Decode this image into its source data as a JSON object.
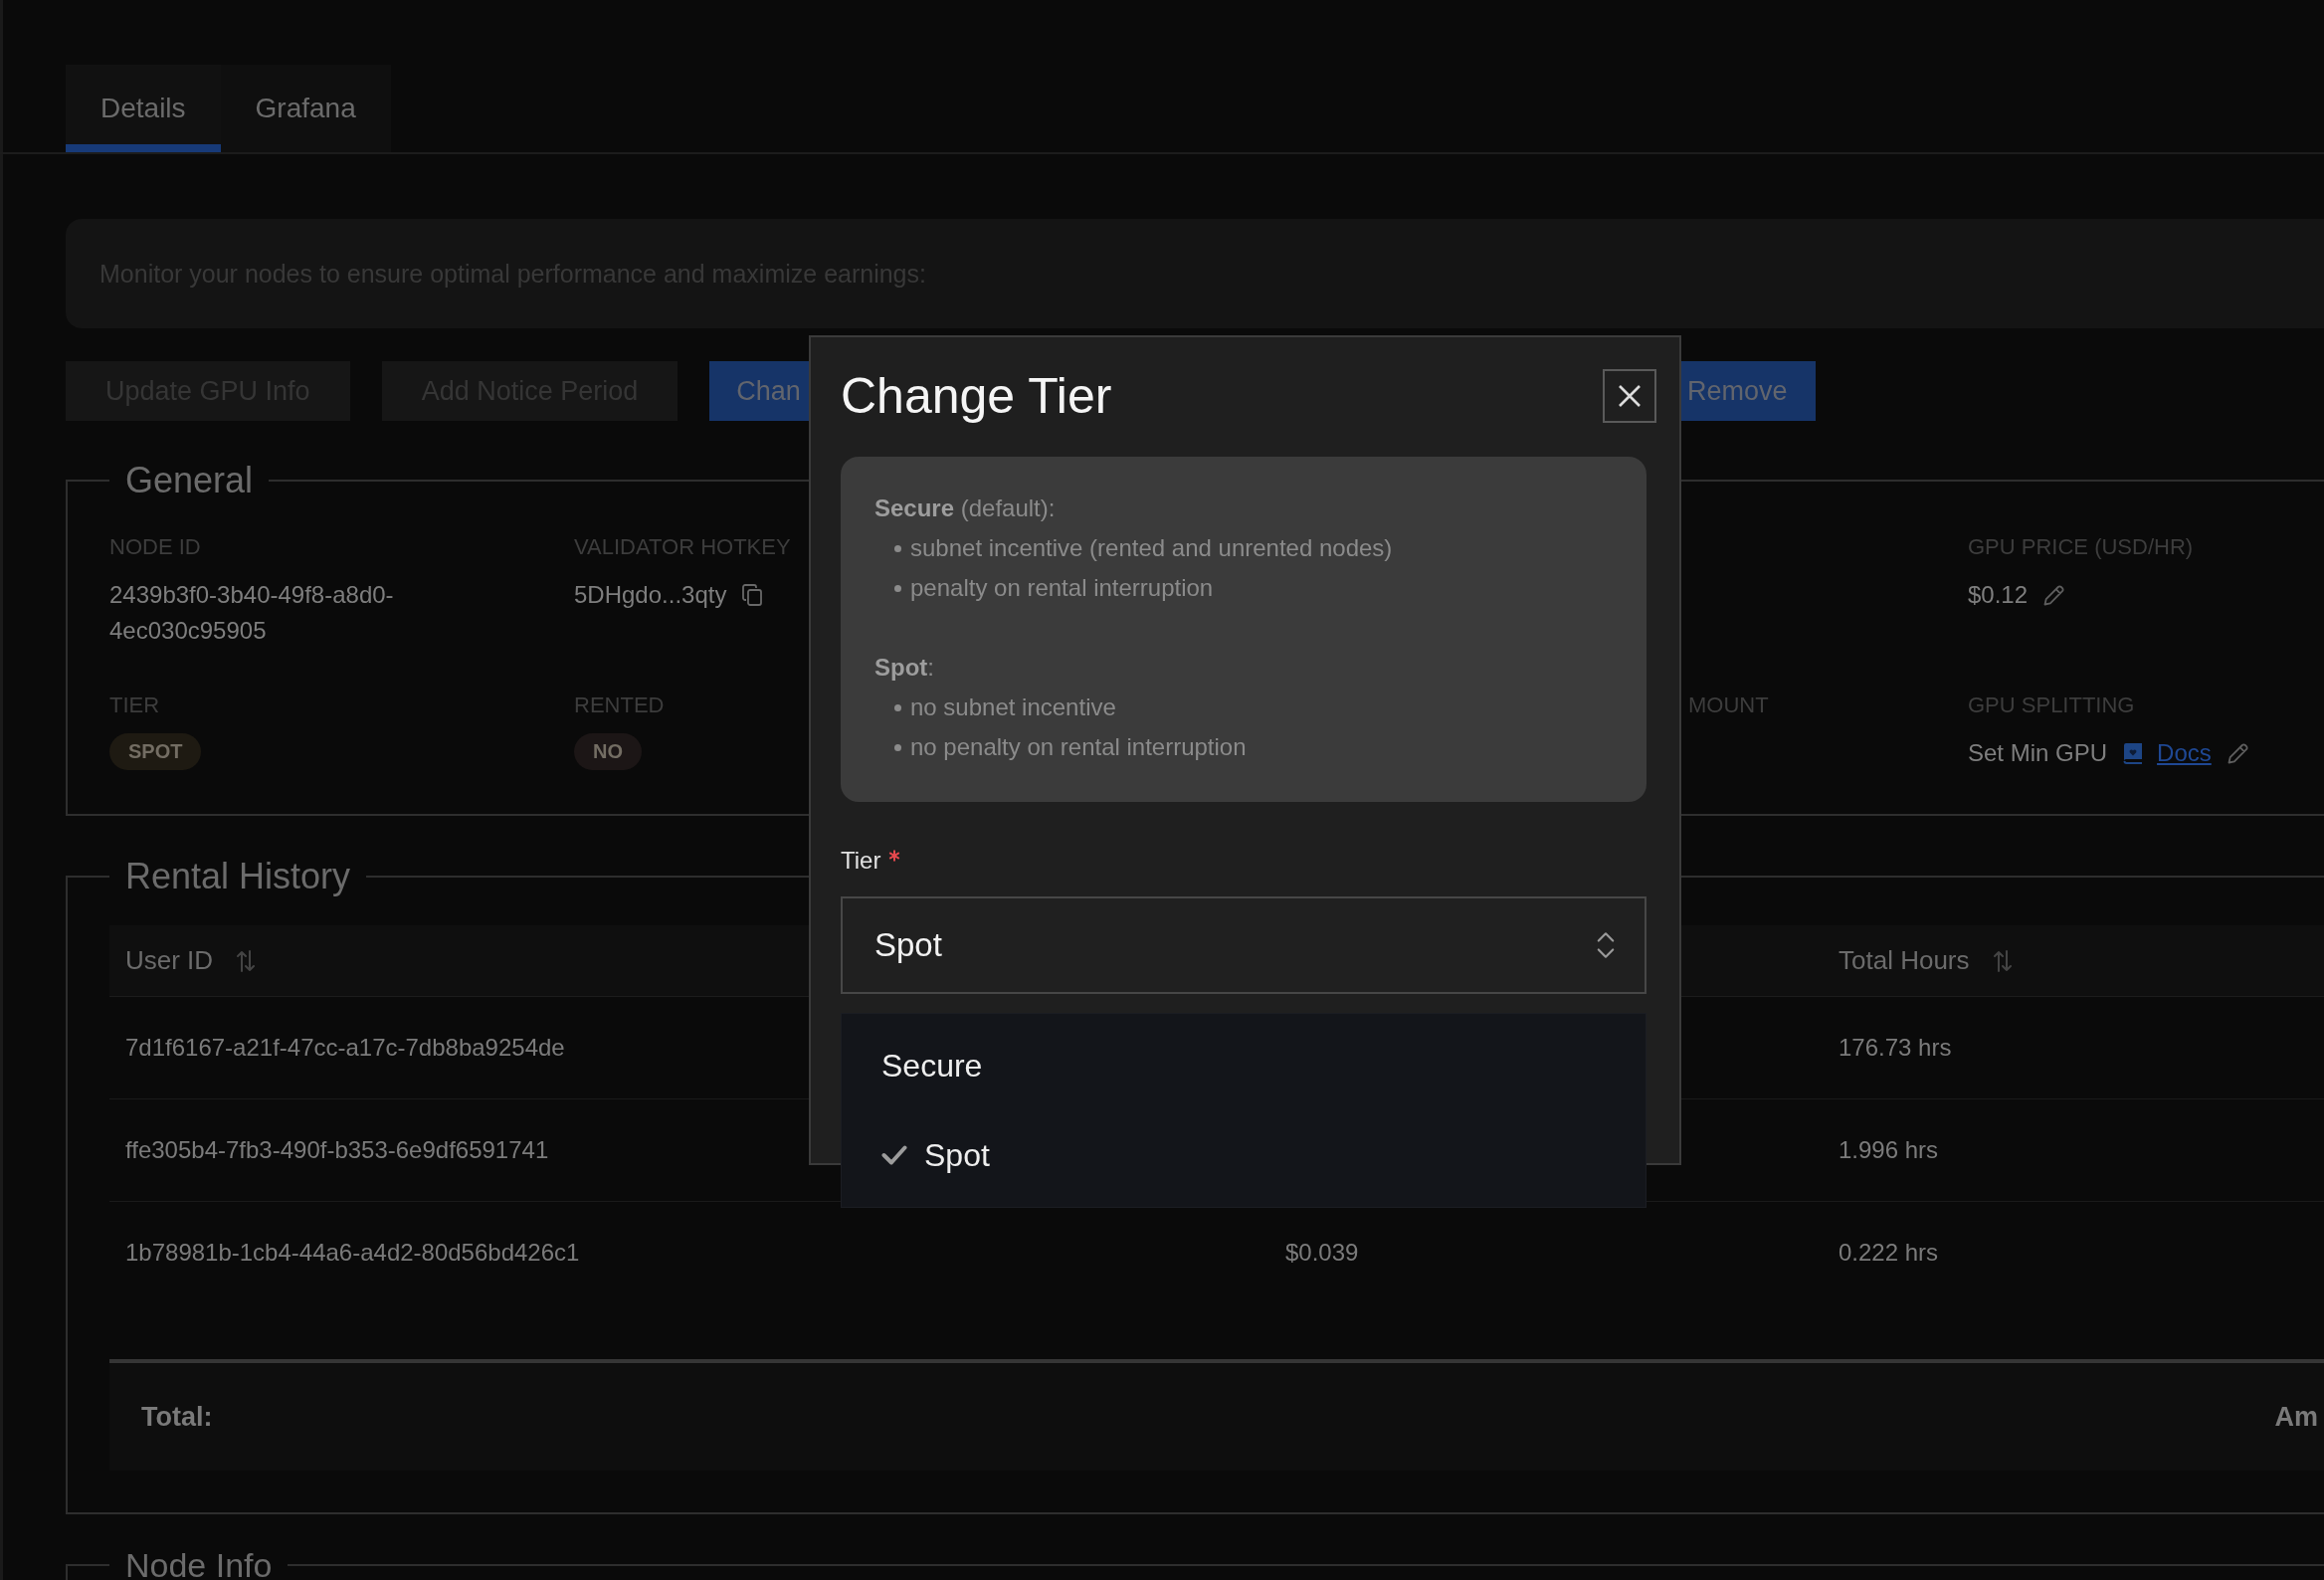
{
  "tabs": [
    {
      "label": "Details",
      "selected": true
    },
    {
      "label": "Grafana",
      "selected": false
    }
  ],
  "notice": "Monitor your nodes to ensure optimal performance and maximize earnings:",
  "actions": [
    {
      "label": "Update GPU Info",
      "kind": "secondary"
    },
    {
      "label": "Add Notice Period",
      "kind": "secondary"
    },
    {
      "label": "Chan",
      "kind": "primary"
    },
    {
      "label": "Remove",
      "kind": "primary"
    }
  ],
  "general": {
    "title": "General",
    "rows": [
      [
        {
          "kind": "text",
          "label": "NODE ID",
          "value": "2439b3f0-3b40-49f8-a8d0-4ec030c95905"
        },
        {
          "kind": "copyable",
          "label": "VALIDATOR HOTKEY",
          "value": "5DHgdo...3qty"
        },
        "",
        "",
        {
          "kind": "editable",
          "label": "GPU PRICE (USD/HR)",
          "value": "$0.12"
        }
      ],
      [
        {
          "kind": "badge",
          "label": "TIER",
          "value": "SPOT",
          "color": "#1e1a12"
        },
        {
          "kind": "badge",
          "label": "RENTED",
          "value": "NO",
          "color": "#1c1616"
        },
        "",
        {
          "kind": "heading",
          "label": "MOUNT"
        },
        {
          "kind": "documented",
          "label": "GPU SPLITTING",
          "value": "Set Min GPU",
          "link": "Docs"
        }
      ]
    ]
  },
  "rental_history": {
    "title": "Rental History",
    "table": {
      "columns": [
        {
          "label": "User ID",
          "sortable": true
        },
        {
          "label": "Total Hours",
          "sortable": true
        }
      ],
      "rows": [
        {
          "user_id": "7d1f6167-a21f-47cc-a17c-7db8ba9254de",
          "total_hours": "176.73 hrs"
        },
        {
          "user_id": "ffe305b4-7fb3-490f-b353-6e9df6591741",
          "total_hours": "1.996 hrs"
        },
        {
          "user_id": "1b78981b-1cb4-44a6-a4d2-80d56bd426c1",
          "column_2": "$0.039",
          "total_hours": "0.222 hrs"
        }
      ]
    },
    "footer": {
      "label": "Total:",
      "column_end": "Am"
    }
  },
  "node_info": {
    "title": "Node Info"
  },
  "modal": {
    "title": "Change Tier",
    "info": [
      {
        "heading": "**Secure** (default):",
        "bullets": [
          "subnet incentive (rented and unrented nodes)",
          "penalty on rental interruption"
        ]
      },
      {
        "heading": "**Spot**:",
        "bullets": [
          "no subnet incentive",
          "no penalty on rental interruption"
        ]
      }
    ],
    "field": {
      "label": "Tier",
      "required": true,
      "value": "Spot",
      "expanded": true,
      "options": [
        {
          "label": "Secure",
          "selected": false
        },
        {
          "label": "Spot",
          "selected": true
        }
      ]
    }
  }
}
